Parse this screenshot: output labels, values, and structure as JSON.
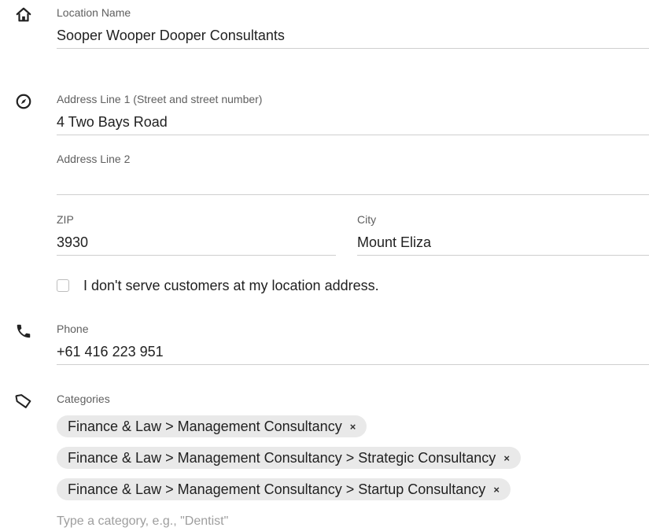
{
  "location_name": {
    "label": "Location Name",
    "value": "Sooper Wooper Dooper Consultants"
  },
  "address": {
    "line1_label": "Address Line 1 (Street and street number)",
    "line1_value": "4 Two Bays Road",
    "line2_label": "Address Line 2",
    "line2_value": "",
    "zip_label": "ZIP",
    "zip_value": "3930",
    "city_label": "City",
    "city_value": "Mount Eliza",
    "no_customers_label": "I don't serve customers at my location address."
  },
  "phone": {
    "label": "Phone",
    "value": "+61 416 223 951"
  },
  "categories": {
    "label": "Categories",
    "items": [
      {
        "label": "Finance & Law > Management Consultancy",
        "remove": "×"
      },
      {
        "label": "Finance & Law > Management Consultancy > Strategic Consultancy",
        "remove": "×"
      },
      {
        "label": "Finance & Law > Management Consultancy > Startup Consultancy",
        "remove": "×"
      }
    ],
    "placeholder": "Type a category, e.g., \"Dentist\""
  },
  "icons": {
    "name": "home-icon",
    "address": "compass-icon",
    "phone": "phone-icon",
    "categories": "tag-icon"
  },
  "colors": {
    "text": "#212121",
    "label": "#5f5f5f",
    "underline": "#cfcfcf",
    "chip_bg": "#e9e9e9",
    "placeholder": "#9e9e9e"
  }
}
